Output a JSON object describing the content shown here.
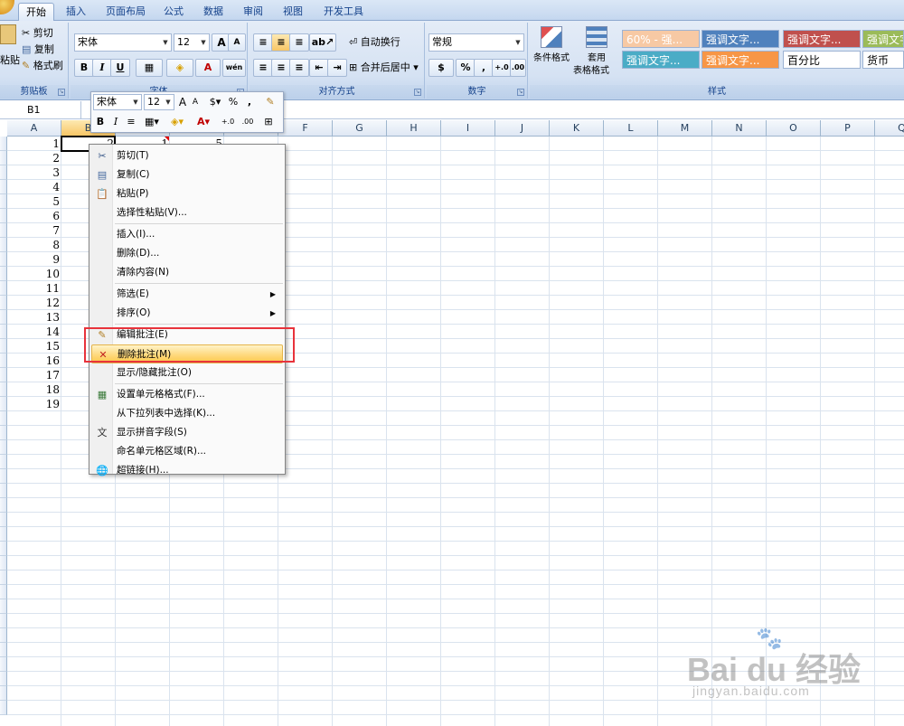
{
  "tabs": [
    "开始",
    "插入",
    "页面布局",
    "公式",
    "数据",
    "审阅",
    "视图",
    "开发工具"
  ],
  "clipboard": {
    "paste": "粘贴",
    "cut": "剪切",
    "copy": "复制",
    "format_painter": "格式刷",
    "label": "剪贴板"
  },
  "font": {
    "name": "宋体",
    "size": "12",
    "label": "字体",
    "bold": "B",
    "italic": "I",
    "underline": "U",
    "grow": "A",
    "shrink": "A",
    "color_letter": "A",
    "phonetic": "wén"
  },
  "alignment": {
    "wrap": "自动换行",
    "merge": "合并后居中",
    "label": "对齐方式"
  },
  "number": {
    "format": "常规",
    "percent": "%",
    "comma": ",",
    "increase": "+.0",
    "decrease": ".00",
    "label": "数字"
  },
  "styles": {
    "conditional": "条件格式",
    "table_line1": "套用",
    "table_line2": "表格格式",
    "label": "样式",
    "cells": [
      "60% - 强...",
      "强调文字...",
      "强调文字...",
      "强调文字",
      "强调文字...",
      "强调文字...",
      "百分比",
      "货币"
    ],
    "colors": [
      "#f7c9a4",
      "#4f81bd",
      "#c0504d",
      "#9bbb59",
      "#4bacc6",
      "#f79646",
      "#ffffff",
      "#ffffff"
    ]
  },
  "formula_bar": {
    "name_box": "B1"
  },
  "grid": {
    "columns": [
      "A",
      "B",
      "C",
      "D",
      "E",
      "F",
      "G",
      "H",
      "I",
      "J",
      "K",
      "L",
      "M",
      "N",
      "O",
      "P",
      "Q"
    ],
    "row_numbers": [
      "1",
      "2",
      "3",
      "4",
      "5",
      "6",
      "7",
      "8",
      "9",
      "10",
      "11",
      "12",
      "13",
      "14",
      "15",
      "16",
      "17",
      "18",
      "19"
    ],
    "row1_values": [
      "2",
      "1",
      "5"
    ]
  },
  "minibar": {
    "font": "宋体",
    "size": "12",
    "grow": "A",
    "shrink": "A",
    "percent": "%",
    "comma": ",",
    "bold": "B",
    "italic": "I",
    "color_letter": "A",
    "increase": "+.0",
    "decrease": ".00"
  },
  "context_menu": {
    "items": [
      {
        "label": "剪切(T)",
        "icon": "scissors-icon"
      },
      {
        "label": "复制(C)",
        "icon": "copy-icon"
      },
      {
        "label": "粘贴(P)",
        "icon": "paste-icon"
      },
      {
        "label": "选择性粘贴(V)...",
        "icon": ""
      },
      {
        "label": "插入(I)...",
        "icon": ""
      },
      {
        "label": "删除(D)...",
        "icon": ""
      },
      {
        "label": "清除内容(N)",
        "icon": ""
      },
      {
        "label": "筛选(E)",
        "icon": "",
        "submenu": true
      },
      {
        "label": "排序(O)",
        "icon": "",
        "submenu": true
      },
      {
        "label": "编辑批注(E)",
        "icon": "edit-comment-icon"
      },
      {
        "label": "删除批注(M)",
        "icon": "delete-comment-icon",
        "highlighted": true
      },
      {
        "label": "显示/隐藏批注(O)",
        "icon": ""
      },
      {
        "label": "设置单元格格式(F)...",
        "icon": "format-cells-icon"
      },
      {
        "label": "从下拉列表中选择(K)...",
        "icon": ""
      },
      {
        "label": "显示拼音字段(S)",
        "icon": "phonetic-icon"
      },
      {
        "label": "命名单元格区域(R)...",
        "icon": ""
      },
      {
        "label": "超链接(H)...",
        "icon": "hyperlink-icon"
      }
    ]
  },
  "watermark": {
    "brand": "Bai du 经验",
    "url": "jingyan.baidu.com"
  }
}
